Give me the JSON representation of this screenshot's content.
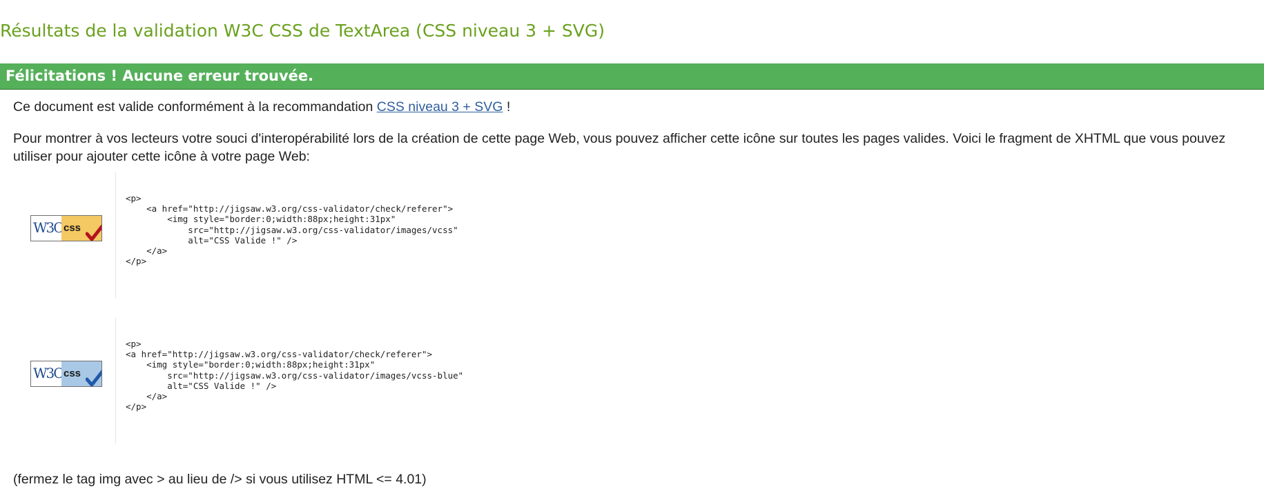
{
  "page": {
    "title": "Résultats de la validation W3C CSS de TextArea (CSS niveau 3 + SVG)"
  },
  "banner": {
    "message": "Félicitations ! Aucune erreur trouvée.",
    "color": "#55b05a"
  },
  "validity": {
    "text_before": "Ce document est valide conformément à la recommandation ",
    "link_text": "CSS niveau 3 + SVG",
    "text_after": " !"
  },
  "interop_text": "Pour montrer à vos lecteurs votre souci d'interopérabilité lors de la création de cette page Web, vous pouvez afficher cette icône sur toutes les pages valides. Voici le fragment de XHTML que vous pouvez utiliser pour ajouter cette icône à votre page Web:",
  "badges": [
    {
      "w3c_text": "W3C",
      "css_text": "css",
      "style": "gold",
      "background_color": "#f4c863",
      "check_color": "#b3121f",
      "check_icon": "checkmark-icon",
      "code": "<p>\n    <a href=\"http://jigsaw.w3.org/css-validator/check/referer\">\n        <img style=\"border:0;width:88px;height:31px\"\n            src=\"http://jigsaw.w3.org/css-validator/images/vcss\"\n            alt=\"CSS Valide !\" />\n    </a>\n</p>"
    },
    {
      "w3c_text": "W3C",
      "css_text": "css",
      "style": "blue",
      "background_color": "#a9c8e6",
      "check_color": "#1e5aa8",
      "check_icon": "checkmark-icon",
      "code": "<p>\n<a href=\"http://jigsaw.w3.org/css-validator/check/referer\">\n    <img style=\"border:0;width:88px;height:31px\"\n        src=\"http://jigsaw.w3.org/css-validator/images/vcss-blue\"\n        alt=\"CSS Valide !\" />\n    </a>\n</p>"
    }
  ],
  "note": "(fermez le tag img avec > au lieu de /> si vous utilisez HTML <= 4.01)",
  "colors": {
    "title": "#6aa11e",
    "link": "#2f5e9e"
  }
}
